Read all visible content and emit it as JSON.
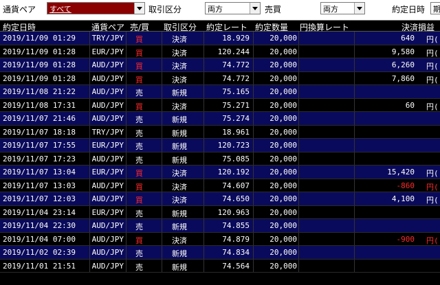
{
  "filters": {
    "pair_label": "通貨ペア",
    "pair_value": "すべて",
    "type_label": "取引区分",
    "type_value": "両方",
    "side_label": "売買",
    "side_value": "両方",
    "date_label": "約定日時",
    "date_value": "期"
  },
  "table": {
    "headers": [
      "約定日時",
      "通貨ペア",
      "売/買",
      "取引区分",
      "約定レート",
      "約定数量",
      "円換算レート",
      "決済損益"
    ],
    "rows": [
      {
        "date": "2019/11/09 01:29",
        "pair": "TRY/JPY",
        "side": "買",
        "type": "決済",
        "rate": "18.929",
        "qty": "20,000",
        "pl": "640",
        "cur": "円(",
        "neg": false,
        "buy": true
      },
      {
        "date": "2019/11/09 01:28",
        "pair": "EUR/JPY",
        "side": "買",
        "type": "決済",
        "rate": "120.244",
        "qty": "20,000",
        "pl": "9,580",
        "cur": "円(",
        "neg": false,
        "buy": true
      },
      {
        "date": "2019/11/09 01:28",
        "pair": "AUD/JPY",
        "side": "買",
        "type": "決済",
        "rate": "74.772",
        "qty": "20,000",
        "pl": "6,260",
        "cur": "円(",
        "neg": false,
        "buy": true
      },
      {
        "date": "2019/11/09 01:28",
        "pair": "AUD/JPY",
        "side": "買",
        "type": "決済",
        "rate": "74.772",
        "qty": "20,000",
        "pl": "7,860",
        "cur": "円(",
        "neg": false,
        "buy": true
      },
      {
        "date": "2019/11/08 21:22",
        "pair": "AUD/JPY",
        "side": "売",
        "type": "新規",
        "rate": "75.165",
        "qty": "20,000",
        "pl": "",
        "cur": "",
        "neg": false,
        "buy": false
      },
      {
        "date": "2019/11/08 17:31",
        "pair": "AUD/JPY",
        "side": "買",
        "type": "決済",
        "rate": "75.271",
        "qty": "20,000",
        "pl": "60",
        "cur": "円(",
        "neg": false,
        "buy": true
      },
      {
        "date": "2019/11/07 21:46",
        "pair": "AUD/JPY",
        "side": "売",
        "type": "新規",
        "rate": "75.274",
        "qty": "20,000",
        "pl": "",
        "cur": "",
        "neg": false,
        "buy": false
      },
      {
        "date": "2019/11/07 18:18",
        "pair": "TRY/JPY",
        "side": "売",
        "type": "新規",
        "rate": "18.961",
        "qty": "20,000",
        "pl": "",
        "cur": "",
        "neg": false,
        "buy": false
      },
      {
        "date": "2019/11/07 17:55",
        "pair": "EUR/JPY",
        "side": "売",
        "type": "新規",
        "rate": "120.723",
        "qty": "20,000",
        "pl": "",
        "cur": "",
        "neg": false,
        "buy": false
      },
      {
        "date": "2019/11/07 17:23",
        "pair": "AUD/JPY",
        "side": "売",
        "type": "新規",
        "rate": "75.085",
        "qty": "20,000",
        "pl": "",
        "cur": "",
        "neg": false,
        "buy": false
      },
      {
        "date": "2019/11/07 13:04",
        "pair": "EUR/JPY",
        "side": "買",
        "type": "決済",
        "rate": "120.192",
        "qty": "20,000",
        "pl": "15,420",
        "cur": "円(",
        "neg": false,
        "buy": true
      },
      {
        "date": "2019/11/07 13:03",
        "pair": "AUD/JPY",
        "side": "買",
        "type": "決済",
        "rate": "74.607",
        "qty": "20,000",
        "pl": "-860",
        "cur": "円(",
        "neg": true,
        "buy": true
      },
      {
        "date": "2019/11/07 12:03",
        "pair": "AUD/JPY",
        "side": "買",
        "type": "決済",
        "rate": "74.650",
        "qty": "20,000",
        "pl": "4,100",
        "cur": "円(",
        "neg": false,
        "buy": true
      },
      {
        "date": "2019/11/04 23:14",
        "pair": "EUR/JPY",
        "side": "売",
        "type": "新規",
        "rate": "120.963",
        "qty": "20,000",
        "pl": "",
        "cur": "",
        "neg": false,
        "buy": false
      },
      {
        "date": "2019/11/04 22:30",
        "pair": "AUD/JPY",
        "side": "売",
        "type": "新規",
        "rate": "74.855",
        "qty": "20,000",
        "pl": "",
        "cur": "",
        "neg": false,
        "buy": false
      },
      {
        "date": "2019/11/04 07:00",
        "pair": "AUD/JPY",
        "side": "買",
        "type": "決済",
        "rate": "74.879",
        "qty": "20,000",
        "pl": "-900",
        "cur": "円(",
        "neg": true,
        "buy": true
      },
      {
        "date": "2019/11/02 02:39",
        "pair": "AUD/JPY",
        "side": "売",
        "type": "新規",
        "rate": "74.834",
        "qty": "20,000",
        "pl": "",
        "cur": "",
        "neg": false,
        "buy": false
      },
      {
        "date": "2019/11/01 21:51",
        "pair": "AUD/JPY",
        "side": "売",
        "type": "新規",
        "rate": "74.564",
        "qty": "20,000",
        "pl": "",
        "cur": "",
        "neg": false,
        "buy": false
      }
    ]
  },
  "colors": {
    "row_highlight": "#0a0a5c",
    "buy_text": "#ff2a2a",
    "negative_pl": "#ff2a2a",
    "pair_filter_bg": "#8b0000"
  }
}
